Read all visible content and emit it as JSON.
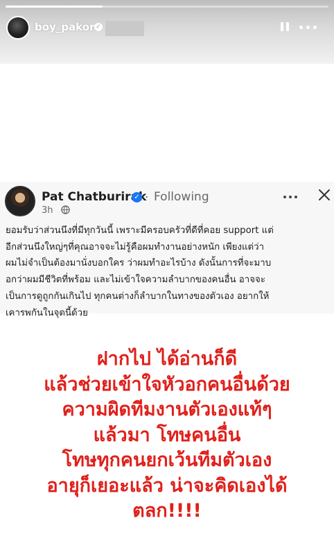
{
  "story": {
    "username": "boy_pakorn",
    "progress": 0.3
  },
  "post": {
    "author": "Pat Chatburirak",
    "following_label": "Following",
    "time": "3h",
    "body_lines": [
      "ยอมรับว่าส่วนนึงที่มีทุกวันนี้ เพราะมีครอบครัวที่ดีที่คอย support แต่",
      "อีกส่วนนึงใหญ่ๆที่คุณอาจจะไม่รู้คือผมทำงานอย่างหนัก เพียงแต่ว่า",
      "ผมไม่จำเป็นต้องมานั่งบอกใคร ว่าผมทำอะไรบ้าง ดังนั้นการที่จะมาบ",
      "อกว่าผมมีชีวิตที่พร้อม และไม่เข้าใจความลำบากของคนอื่น อาจจะ",
      "เป็นการดูถูกกันเกินไป  ทุกคนต่างก็ลำบากในทางของตัวเอง อยากให้",
      "เคารพกันในจุดนี้ด้วย"
    ]
  },
  "overlay": {
    "lines": [
      "ฝากไป ได้อ่านก็ดี",
      "แล้วช่วยเข้าใจหัวอกคนอื่นด้วย",
      "ความผิดทีมงานตัวเองแท้ๆ",
      "แล้วมา โทษคนอื่น",
      "โทษทุกคนยกเว้นทีมตัวเอง",
      "อายุก็เยอะแล้ว น่าจะคิดเองได้",
      "ตลก!!!!"
    ]
  },
  "colors": {
    "overlay_text": "#e0201b",
    "fb_blue": "#1877f2"
  }
}
